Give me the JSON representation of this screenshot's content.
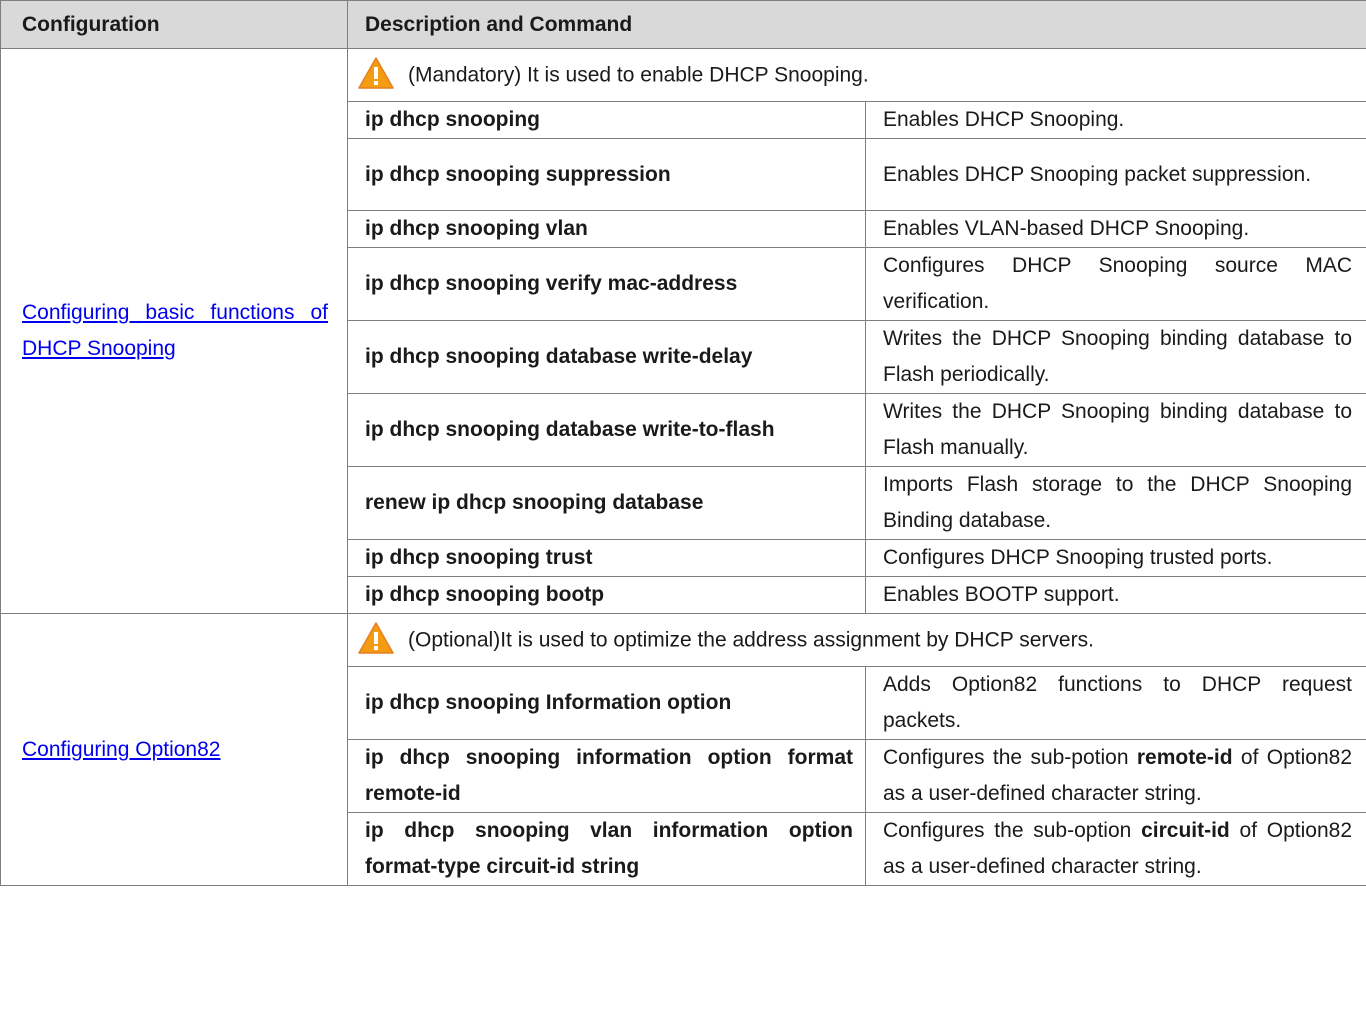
{
  "table": {
    "headers": [
      "Configuration",
      "Description and Command"
    ],
    "sections": [
      {
        "config_link": "Configuring basic functions of DHCP Snooping",
        "note": "(Mandatory) It is used to enable DHCP Snooping.",
        "rows": [
          {
            "command": "ip dhcp snooping",
            "description": "Enables DHCP Snooping."
          },
          {
            "command": "ip dhcp snooping suppression",
            "description": "Enables DHCP Snooping packet suppression."
          },
          {
            "command": "ip dhcp snooping vlan",
            "description": "Enables VLAN-based DHCP Snooping."
          },
          {
            "command": "ip dhcp snooping verify mac-address",
            "description": "Configures DHCP Snooping source MAC verification."
          },
          {
            "command": "ip dhcp snooping database write-delay",
            "description": "Writes the DHCP Snooping binding database to Flash periodically."
          },
          {
            "command": "ip dhcp snooping database write-to-flash",
            "description": "Writes the DHCP Snooping binding database to Flash manually."
          },
          {
            "command": "renew ip dhcp snooping database",
            "description": "Imports Flash storage to the DHCP Snooping Binding database."
          },
          {
            "command": "ip dhcp snooping trust",
            "description": "Configures DHCP Snooping trusted ports."
          },
          {
            "command": "ip dhcp snooping bootp",
            "description": "Enables BOOTP support."
          }
        ]
      },
      {
        "config_link": "Configuring Option82",
        "note": "(Optional)It is used to optimize the address assignment by DHCP servers.",
        "rows": [
          {
            "command": "ip dhcp snooping Information option",
            "description": "Adds Option82 functions to DHCP request packets."
          },
          {
            "command": "ip dhcp snooping information option format remote-id",
            "description_parts": [
              "Configures the sub-potion ",
              "remote-id",
              " of Option82 as a user-defined character string."
            ]
          },
          {
            "command": "ip dhcp snooping vlan information option format-type circuit-id string",
            "description_parts": [
              "Configures the sub-option ",
              "circuit-id",
              " of Option82 as a user-defined character string."
            ]
          }
        ]
      }
    ]
  },
  "icons": {
    "note_icon": "warning-icon",
    "warning_color": "#f39c12"
  }
}
